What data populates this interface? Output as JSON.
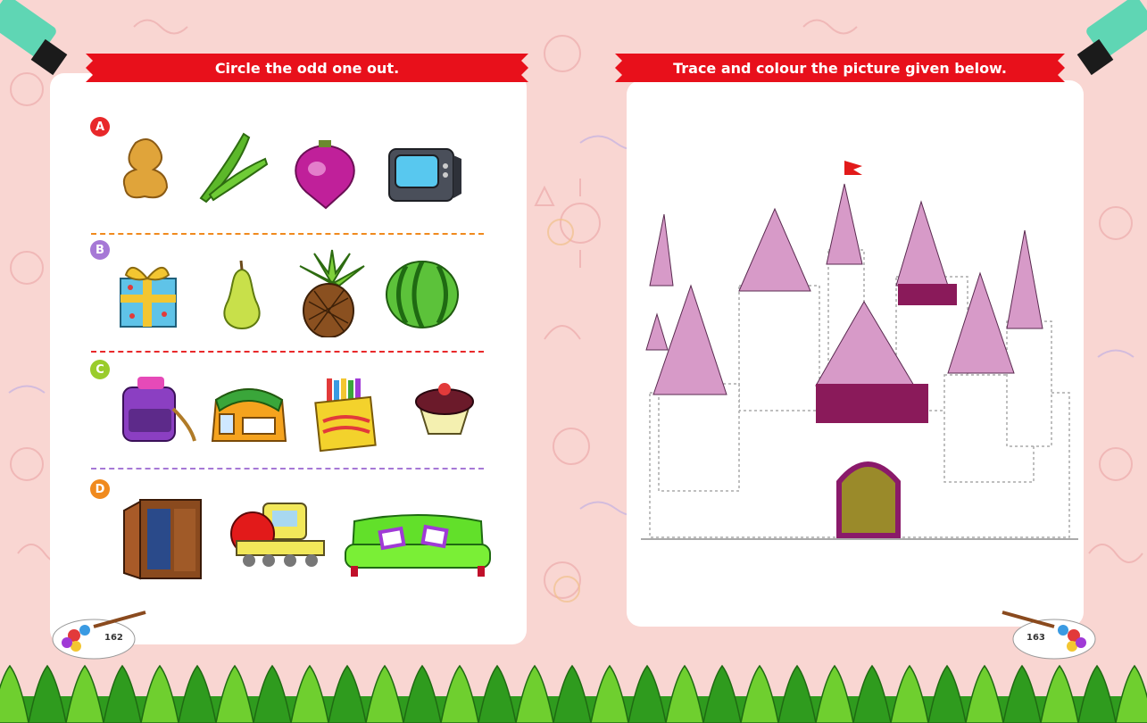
{
  "left_page": {
    "instruction": "Circle the odd one out.",
    "page_number": "162",
    "rows": [
      {
        "label": "A",
        "color": "#e8282a",
        "items": [
          "ginger",
          "okra",
          "turnip",
          "television"
        ]
      },
      {
        "label": "B",
        "color": "#a678d6",
        "items": [
          "gift-box",
          "pear",
          "pineapple",
          "watermelon"
        ]
      },
      {
        "label": "C",
        "color": "#9acc2c",
        "items": [
          "school-bag",
          "backpack",
          "crayon-box",
          "cupcake"
        ]
      },
      {
        "label": "D",
        "color": "#f08a1e",
        "items": [
          "wardrobe",
          "toy-train",
          "sofa"
        ]
      }
    ],
    "divider_colors": [
      "#f08a1e",
      "#e8282a",
      "#a678d6"
    ]
  },
  "right_page": {
    "instruction": "Trace and colour the picture given below.",
    "page_number": "163",
    "picture": "castle"
  },
  "colors": {
    "banner": "#e8101b",
    "background": "#f9d6d2",
    "grass": "#2f9b1e",
    "grass_light": "#6fcf2f"
  }
}
